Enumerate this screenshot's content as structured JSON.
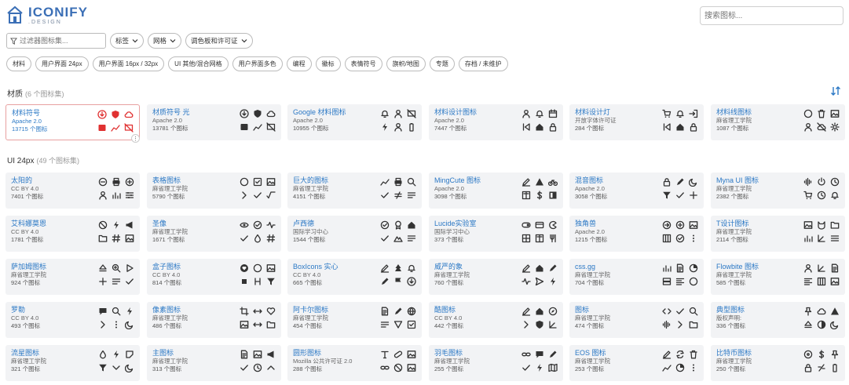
{
  "header": {
    "logo_main": "ICONIFY",
    "logo_sub": ".DESIGN",
    "search_placeholder": "搜索图标..."
  },
  "filters": {
    "filter_placeholder": "过滤器图标集...",
    "dropdowns": [
      "标签",
      "网格",
      "调色板和许可证"
    ]
  },
  "tags": [
    "材料",
    "用户界面 24px",
    "用户界面 16px / 32px",
    "UI 其他/混合网格",
    "用户界面多色",
    "编程",
    "徽标",
    "表情符号",
    "旗帜/地图",
    "专题",
    "存档 / 未维护"
  ],
  "sections": [
    {
      "title": "材质",
      "count": "(6 个图标集)"
    },
    {
      "title": "UI 24px",
      "count": "(49 个图标集)"
    }
  ],
  "colors": {
    "accent": "#2b78c5",
    "red": "#e03131",
    "card": "#f2f3f5"
  },
  "material_cards": [
    {
      "name": "材料符号",
      "license": "Apache 2.0",
      "count": "13715 个图标",
      "icons": [
        "download-icon",
        "shield-icon",
        "cloud-icon",
        "badge-icon",
        "chart-icon",
        "no-screen-icon"
      ]
    },
    {
      "name": "材质符号 光",
      "license": "Apache 2.0",
      "count": "13781 个图标",
      "icons": [
        "download-icon",
        "shield-icon",
        "cloud-icon",
        "badge-icon",
        "chart-icon",
        "no-screen-icon"
      ]
    },
    {
      "name": "Google 材料图标",
      "license": "Apache 2.0",
      "count": "10955 个图标",
      "icons": [
        "bell-icon",
        "person-icon",
        "no-screen-icon",
        "bolt-icon",
        "person-icon",
        "battery-icon"
      ]
    },
    {
      "name": "材料设计图标",
      "license": "Apache 2.0",
      "count": "7447 个图标",
      "icons": [
        "person-icon",
        "bell-icon",
        "calendar-icon",
        "skip-icon",
        "home-icon",
        "lock-icon"
      ]
    },
    {
      "name": "材料设计灯",
      "license": "开放字体许可证",
      "count": "284 个图标",
      "icons": [
        "cart-icon",
        "bell-icon",
        "login-icon",
        "skip-icon",
        "home-icon",
        "lock-icon"
      ]
    },
    {
      "name": "材料线图标",
      "license": "麻省理工学院",
      "count": "1087 个图标",
      "icons": [
        "circle-icon",
        "trash-icon",
        "image-icon",
        "person-icon",
        "cloud-off-icon",
        "gear-icon"
      ]
    }
  ],
  "ui_cards": [
    {
      "name": "太阳的",
      "license": "CC BY 4.0",
      "count": "7401 个图标",
      "icons": [
        "minus-circle-icon",
        "printer-icon",
        "plus-circle-icon",
        "person-icon",
        "bars-icon",
        "sliders-icon"
      ]
    },
    {
      "name": "表格图标",
      "license": "麻省理工学院",
      "count": "5790 个图标",
      "icons": [
        "circle-icon",
        "check-square-icon",
        "image-icon",
        "chevron-right-icon",
        "check-icon",
        "sqrt-icon"
      ]
    },
    {
      "name": "巨大的图标",
      "license": "麻省理工学院",
      "count": "4151 个图标",
      "icons": [
        "chart-icon",
        "printer-icon",
        "search-icon",
        "check-icon",
        "neq-icon",
        "list-icon"
      ]
    },
    {
      "name": "MingCute 图标",
      "license": "Apache 2.0",
      "count": "3098 个图标",
      "icons": [
        "edit-icon",
        "warning-icon",
        "bike-icon",
        "book-icon",
        "dollar-icon",
        "layout-icon"
      ]
    },
    {
      "name": "混音图标",
      "license": "Apache 2.0",
      "count": "3058 个图标",
      "icons": [
        "lock-icon",
        "pen-icon",
        "moon-icon",
        "filter-icon",
        "check-icon",
        "plus-icon"
      ]
    },
    {
      "name": "Myna UI 图标",
      "license": "麻省理工学院",
      "count": "2382 个图标",
      "icons": [
        "wave-icon",
        "power-icon",
        "clock-icon",
        "cart-icon",
        "clock-icon",
        "bell-icon"
      ]
    },
    {
      "name": "艾科娜莫恩",
      "license": "CC BY 4.0",
      "count": "1781 个图标",
      "icons": [
        "no-sign-icon",
        "bolt-icon",
        "megaphone-icon",
        "folder-icon",
        "hash-icon",
        "image-icon"
      ]
    },
    {
      "name": "圣像",
      "license": "麻省理工学院",
      "count": "1671 个图标",
      "icons": [
        "eye-icon",
        "check-circle-icon",
        "pulse-icon",
        "check-icon",
        "drop-icon",
        "hash-icon"
      ]
    },
    {
      "name": "卢西德",
      "license": "国际学习中心",
      "count": "1544 个图标",
      "icons": [
        "check-circle-icon",
        "award-icon",
        "home-icon",
        "check-icon",
        "mountain-icon",
        "list-icon"
      ]
    },
    {
      "name": "Lucide实验室",
      "license": "国际学习中心",
      "count": "373 个图标",
      "icons": [
        "toggle-icon",
        "wallet-icon",
        "pacman-icon",
        "grid-icon",
        "book-icon",
        "fork-icon"
      ]
    },
    {
      "name": "独角兽",
      "license": "Apache 2.0",
      "count": "1215 个图标",
      "icons": [
        "arrow-right-icon",
        "plus-circle-icon",
        "image-icon",
        "columns-icon",
        "check-circle-icon",
        "dots-icon"
      ]
    },
    {
      "name": "T设计图标",
      "license": "麻省理工学院",
      "count": "2114 个图标",
      "icons": [
        "image-icon",
        "cat-icon",
        "folder-icon",
        "bars-icon",
        "angle-icon",
        "menu-icon"
      ]
    },
    {
      "name": "萨加姆图标",
      "license": "麻省理工学院",
      "count": "924 个图标",
      "icons": [
        "eject-icon",
        "zoom-icon",
        "play-icon",
        "plus-icon",
        "list-icon",
        "check-icon"
      ]
    },
    {
      "name": "盒子图标",
      "license": "CC BY 4.0",
      "count": "814 个图标",
      "icons": [
        "heart-circle-icon",
        "circle-icon",
        "image-icon",
        "stop-icon",
        "h-icon",
        "filter-icon"
      ]
    },
    {
      "name": "BoxIcons 实心",
      "license": "CC BY 4.0",
      "count": "665 个图标",
      "icons": [
        "edit-icon",
        "tree-icon",
        "bell-icon",
        "pen-icon",
        "flag-icon",
        "download-icon"
      ]
    },
    {
      "name": "威严的象",
      "license": "麻省理工学院",
      "count": "760 个图标",
      "icons": [
        "edit-icon",
        "home-icon",
        "pen-icon",
        "pulse-icon",
        "send-icon",
        "bolt-icon"
      ]
    },
    {
      "name": "css.gg",
      "license": "麻省理工学院",
      "count": "704 个图标",
      "icons": [
        "bars-icon",
        "file-icon",
        "pie-icon",
        "server-icon",
        "align-icon",
        "circle-icon"
      ]
    },
    {
      "name": "Flowbite 图标",
      "license": "麻省理工学院",
      "count": "585 个图标",
      "icons": [
        "person-icon",
        "angle-icon",
        "file-icon",
        "align-icon",
        "columns-icon",
        "image-icon"
      ]
    },
    {
      "name": "罗勒",
      "license": "CC BY 4.0",
      "count": "493 个图标",
      "icons": [
        "chat-icon",
        "search-icon",
        "bolt-icon",
        "chevron-right-icon",
        "dots-icon",
        "moon-icon"
      ]
    },
    {
      "name": "像素图标",
      "license": "麻省理工学院",
      "count": "486 个图标",
      "icons": [
        "crop-icon",
        "arrows-icon",
        "heart-icon",
        "image-icon",
        "arrows-icon",
        "folder-icon"
      ]
    },
    {
      "name": "阿卡尔图标",
      "license": "麻省理工学院",
      "count": "454 个图标",
      "icons": [
        "file-icon",
        "pen-icon",
        "globe-icon",
        "list-icon",
        "v-icon",
        "check-square-icon"
      ]
    },
    {
      "name": "酷图标",
      "license": "CC BY 4.0",
      "count": "442 个图标",
      "icons": [
        "edit-icon",
        "home-icon",
        "compass-icon",
        "chevron-right-icon",
        "shield-icon",
        "angle-icon"
      ]
    },
    {
      "name": "图标",
      "license": "麻省理工学院",
      "count": "474 个图标",
      "icons": [
        "code-icon",
        "check-icon",
        "search-icon",
        "wave-icon",
        "chevron-right-icon",
        "folder-icon"
      ]
    },
    {
      "name": "典型图标",
      "license": "版权声明:",
      "count": "336 个图标",
      "icons": [
        "pin-icon",
        "cloud-icon",
        "warning-icon",
        "eject-icon",
        "contrast-icon",
        "moon-icon"
      ]
    },
    {
      "name": "流星图标",
      "license": "麻省理工学院",
      "count": "321 个图标",
      "icons": [
        "drop-icon",
        "bolt-icon",
        "corner-icon",
        "filter-icon",
        "chevron-down-icon",
        "moon-icon"
      ]
    },
    {
      "name": "主图标",
      "license": "麻省理工学院",
      "count": "313 个图标",
      "icons": [
        "file-icon",
        "image-icon",
        "megaphone-icon",
        "check-icon",
        "clock-icon",
        "chevron-up-icon"
      ]
    },
    {
      "name": "圆形图标",
      "license": "Mozilla 公共许可证 2.0",
      "count": "288 个图标",
      "icons": [
        "text-icon",
        "pill-icon",
        "image-icon",
        "link-icon",
        "no-sign-icon",
        "image-icon"
      ]
    },
    {
      "name": "羽毛图标",
      "license": "麻省理工学院",
      "count": "255 个图标",
      "icons": [
        "link-icon",
        "chat-icon",
        "pen-icon",
        "check-icon",
        "bolt-icon",
        "map-icon"
      ]
    },
    {
      "name": "EOS 图标",
      "license": "麻省理工学院",
      "count": "253 个图标",
      "icons": [
        "edit-icon",
        "sync-icon",
        "trash-icon",
        "chart-icon",
        "pie-icon",
        "dots-icon"
      ]
    },
    {
      "name": "比特币图标",
      "license": "麻省理工学院",
      "count": "250 个图标",
      "icons": [
        "cd-icon",
        "dollar-icon",
        "pin-icon",
        "lock-icon",
        "slash-icon",
        "battery-icon"
      ]
    }
  ]
}
